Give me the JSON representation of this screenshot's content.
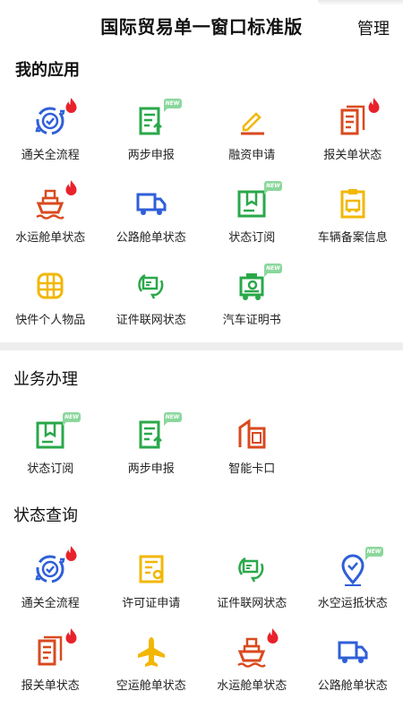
{
  "header": {
    "title": "国际贸易单一窗口标准版",
    "manage_label": "管理"
  },
  "new_badge_text": "NEW",
  "colors": {
    "blue": "#2f5fd8",
    "green": "#2aa84a",
    "orange": "#d94a1f",
    "yellow": "#f2b705",
    "fire": "#e8222b"
  },
  "sections": {
    "my_apps": {
      "title": "我的应用",
      "items": [
        {
          "label": "通关全流程",
          "icon": "customs-flow-icon",
          "badge": "fire"
        },
        {
          "label": "两步申报",
          "icon": "two-step-icon",
          "badge": "new"
        },
        {
          "label": "融资申请",
          "icon": "pen-icon",
          "badge": ""
        },
        {
          "label": "报关单状态",
          "icon": "declaration-doc-icon",
          "badge": "fire"
        },
        {
          "label": "水运舱单状态",
          "icon": "ship-icon",
          "badge": "fire"
        },
        {
          "label": "公路舱单状态",
          "icon": "truck-icon",
          "badge": ""
        },
        {
          "label": "状态订阅",
          "icon": "subscription-icon",
          "badge": "new"
        },
        {
          "label": "车辆备案信息",
          "icon": "vehicle-record-icon",
          "badge": ""
        },
        {
          "label": "快件个人物品",
          "icon": "express-globe-icon",
          "badge": ""
        },
        {
          "label": "证件联网状态",
          "icon": "certificate-network-icon",
          "badge": ""
        },
        {
          "label": "汽车证明书",
          "icon": "car-certificate-icon",
          "badge": "new"
        }
      ]
    },
    "business": {
      "title": "业务办理",
      "items": [
        {
          "label": "状态订阅",
          "icon": "subscription-icon",
          "badge": "new"
        },
        {
          "label": "两步申报",
          "icon": "two-step-icon",
          "badge": "new"
        },
        {
          "label": "智能卡口",
          "icon": "smart-gate-icon",
          "badge": ""
        }
      ]
    },
    "status": {
      "title": "状态查询",
      "items": [
        {
          "label": "通关全流程",
          "icon": "customs-flow-icon",
          "badge": "fire"
        },
        {
          "label": "许可证申请",
          "icon": "license-icon",
          "badge": ""
        },
        {
          "label": "证件联网状态",
          "icon": "certificate-network-icon",
          "badge": ""
        },
        {
          "label": "水空运抵状态",
          "icon": "location-pin-icon",
          "badge": "new"
        },
        {
          "label": "报关单状态",
          "icon": "declaration-doc-icon",
          "badge": "fire"
        },
        {
          "label": "空运舱单状态",
          "icon": "airplane-icon",
          "badge": ""
        },
        {
          "label": "水运舱单状态",
          "icon": "ship-icon",
          "badge": "fire"
        },
        {
          "label": "公路舱单状态",
          "icon": "truck-icon",
          "badge": ""
        }
      ]
    }
  }
}
